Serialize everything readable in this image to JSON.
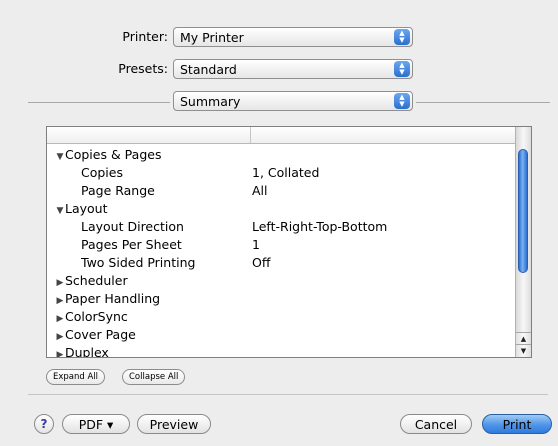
{
  "printer": {
    "label": "Printer:",
    "value": "My Printer"
  },
  "presets": {
    "label": "Presets:",
    "value": "Standard"
  },
  "panel_selector": {
    "value": "Summary"
  },
  "summary_list": {
    "rows": [
      {
        "kind": "group",
        "expanded": true,
        "name": "Copies & Pages",
        "value": ""
      },
      {
        "kind": "item",
        "name": "Copies",
        "value": "1, Collated"
      },
      {
        "kind": "item",
        "name": "Page Range",
        "value": "All"
      },
      {
        "kind": "group",
        "expanded": true,
        "name": "Layout",
        "value": ""
      },
      {
        "kind": "item",
        "name": "Layout Direction",
        "value": "Left-Right-Top-Bottom"
      },
      {
        "kind": "item",
        "name": "Pages Per Sheet",
        "value": "1"
      },
      {
        "kind": "item",
        "name": "Two Sided Printing",
        "value": "Off"
      },
      {
        "kind": "group",
        "expanded": false,
        "name": "Scheduler",
        "value": ""
      },
      {
        "kind": "group",
        "expanded": false,
        "name": "Paper Handling",
        "value": ""
      },
      {
        "kind": "group",
        "expanded": false,
        "name": "ColorSync",
        "value": ""
      },
      {
        "kind": "group",
        "expanded": false,
        "name": "Cover Page",
        "value": ""
      },
      {
        "kind": "group",
        "expanded": false,
        "name": "Duplex",
        "value": ""
      }
    ]
  },
  "expand_all_label": "Expand All",
  "collapse_all_label": "Collapse All",
  "footer": {
    "help_label": "?",
    "pdf_label": "PDF ▾",
    "preview_label": "Preview",
    "cancel_label": "Cancel",
    "print_label": "Print"
  },
  "icons": {
    "popup_arrows": "up-down-arrows-icon",
    "expanded": "▼",
    "collapsed": "▶"
  },
  "colors": {
    "accent_blue": "#2f7ae0",
    "background": "#ececec"
  }
}
